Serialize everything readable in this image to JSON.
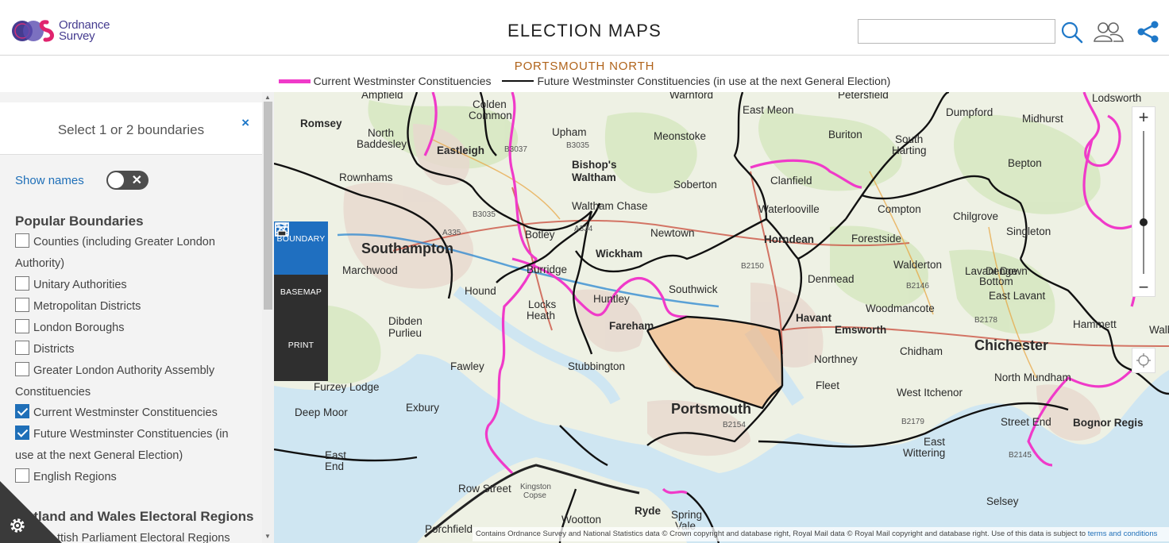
{
  "header": {
    "logo_line1": "Ordnance",
    "logo_line2": "Survey",
    "title": "ELECTION MAPS",
    "search_value": "",
    "icons": [
      "search-icon",
      "users-icon",
      "share-icon"
    ]
  },
  "legend": {
    "title": "PORTSMOUTH NORTH",
    "current_label": "Current Westminster Constituencies",
    "future_label": "Future Westminster Constituencies (in use at the next General Election)",
    "current_color": "#f03ac9",
    "future_color": "#111111"
  },
  "sidebar": {
    "heading": "Select 1 or 2 boundaries",
    "close": "×",
    "show_names_label": "Show names",
    "show_names_on": false,
    "popular_title": "Popular Boundaries",
    "options": [
      {
        "label_a": "Counties (including Greater London",
        "label_b": "Authority)",
        "checked": false
      },
      {
        "label_a": "Unitary Authorities",
        "checked": false
      },
      {
        "label_a": "Metropolitan Districts",
        "checked": false
      },
      {
        "label_a": "London Boroughs",
        "checked": false
      },
      {
        "label_a": "Districts",
        "checked": false
      },
      {
        "label_a": "Greater London Authority Assembly",
        "label_b": "Constituencies",
        "checked": false
      },
      {
        "label_a": "Current Westminster Constituencies",
        "checked": true
      },
      {
        "label_a": "Future Westminster Constituencies (in",
        "label_b": "use at the next General Election)",
        "checked": true
      },
      {
        "label_a": "English Regions",
        "checked": false
      }
    ],
    "section2_title": "otland and Wales Electoral Regions",
    "section2_item": "ttish Parliament Electoral Regions"
  },
  "tools": [
    {
      "label": "BOUNDARY",
      "icon": "boundary-icon",
      "active": true
    },
    {
      "label": "BASEMAP",
      "icon": "map-icon",
      "active": false
    },
    {
      "label": "PRINT",
      "icon": "printer-icon",
      "active": false
    }
  ],
  "map": {
    "place_labels": [
      "Ampfield",
      "Colden Common",
      "Warnford",
      "East Meon",
      "Petersfield",
      "Lodsworth",
      "Romsey",
      "North Baddesley",
      "Eastleigh",
      "Upham",
      "Meonstoke",
      "Buriton",
      "South Harting",
      "Dumpford",
      "Midhurst",
      "Bishop's Waltham",
      "Rownhams",
      "Soberton",
      "Clanfield",
      "Bepton",
      "Compton",
      "Chilgrove",
      "Singleton",
      "Southampton",
      "Botley",
      "Newtown",
      "Horndean",
      "Forestside",
      "Wickham",
      "Marchwood",
      "Burridge",
      "Waterlooville",
      "Walderton",
      "Hound",
      "Southwick",
      "Denmead",
      "Locks Heath",
      "Lavant Down",
      "Denge Bottom",
      "Dibden Purlieu",
      "Fareham",
      "Havant",
      "Woodmancote",
      "East Lavant",
      "Emsworth",
      "Hammett",
      "Chidham",
      "Chichester",
      "Fawley",
      "Stubbington",
      "Northney",
      "North Mundham",
      "Furzey Lodge",
      "Fleet",
      "West Itchenor",
      "Exbury",
      "Portsmouth",
      "Deep Moor",
      "Street End",
      "Bognor Regis",
      "East End",
      "East Wittering",
      "Selsey",
      "Row Street",
      "Kingston Copse",
      "Ryde",
      "Wootton",
      "Porchfield",
      "Spring Vale",
      "Huntley",
      "Waltham Chase",
      "Walbe"
    ],
    "attribution": "Contains Ordnance Survey and National Statistics data © Crown copyright and database right, Royal Mail data © Royal Mail copyright and database right. Use of this data is subject to",
    "attribution_link": "terms and conditions",
    "zoom_in": "+",
    "zoom_out": "−"
  }
}
